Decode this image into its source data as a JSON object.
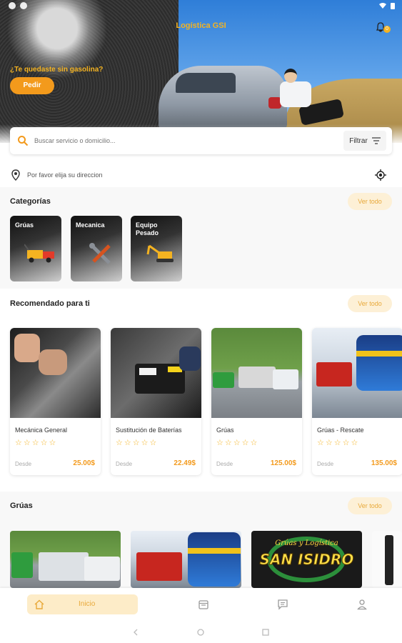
{
  "colors": {
    "accent": "#f39a1c",
    "accent_light": "#fdf0d6",
    "star": "#f4b321"
  },
  "header": {
    "title": "Logística GSI",
    "notification_count": "0",
    "question": "¿Te quedaste sin gasolina?",
    "order_label": "Pedir"
  },
  "search": {
    "placeholder": "Buscar servicio o domicilio...",
    "filter_label": "Filtrar"
  },
  "location": {
    "text": "Por favor elija su direccion"
  },
  "categories": {
    "title": "Categorías",
    "see_all": "Ver todo",
    "items": [
      {
        "label": "Grúas",
        "icon": "tow-truck-icon"
      },
      {
        "label": "Mecanica",
        "icon": "tools-icon"
      },
      {
        "label": "Equipo Pesado",
        "icon": "excavator-icon"
      }
    ]
  },
  "recommended": {
    "title": "Recomendado para ti",
    "see_all": "Ver todo",
    "from_label": "Desde",
    "items": [
      {
        "name": "Mecánica General",
        "price": "25.00$",
        "rating": 0
      },
      {
        "name": "Sustitución de Baterías",
        "price": "22.49$",
        "rating": 0
      },
      {
        "name": "Grúas",
        "price": "125.00$",
        "rating": 0
      },
      {
        "name": "Grúas - Rescate",
        "price": "135.00$",
        "rating": 0
      }
    ]
  },
  "gruas": {
    "title": "Grúas",
    "see_all": "Ver todo",
    "logo_line1": "Grúas y Logística",
    "logo_line2": "SAN ISIDRO"
  },
  "bottom_nav": {
    "home_label": "Inicio"
  }
}
